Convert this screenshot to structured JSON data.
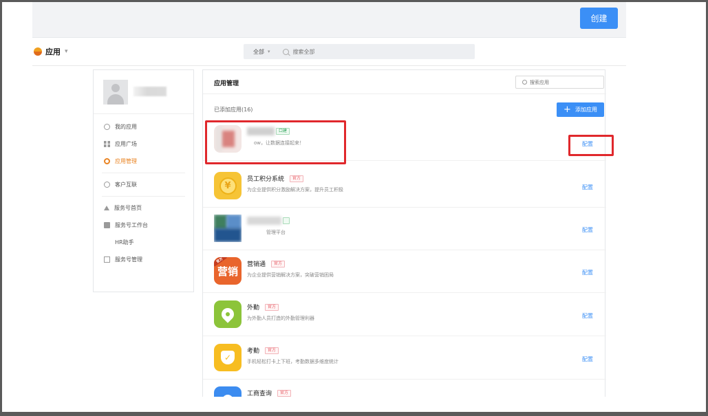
{
  "topbar": {
    "create_label": "创建"
  },
  "nav": {
    "app_menu_label": "应用",
    "search_scope": "全部",
    "search_placeholder": "搜索全部"
  },
  "sidebar": {
    "items": [
      {
        "label": "我的应用",
        "icon": "gear-icon"
      },
      {
        "label": "应用广场",
        "icon": "grid-icon"
      },
      {
        "label": "应用管理",
        "icon": "gear-icon",
        "active": true
      },
      {
        "label": "客户互联",
        "icon": "chat-icon"
      },
      {
        "label": "服务号首页",
        "icon": "home-icon"
      },
      {
        "label": "服务号工作台",
        "icon": "desk-icon"
      },
      {
        "label": "HR助手",
        "icon": ""
      },
      {
        "label": "服务号管理",
        "icon": "manage-icon"
      }
    ]
  },
  "panel": {
    "title": "应用管理",
    "search_placeholder": "搜索应用",
    "added_count": "已添加应用(16)",
    "add_button": "添加应用",
    "config_label": "配置",
    "official_tag": "官方",
    "apps": [
      {
        "name": "",
        "tag": "口建",
        "desc": "ow，让数据连接起来！",
        "icon": "blurred"
      },
      {
        "name": "员工积分系统",
        "tag": "官方",
        "desc": "为企业提供积分激励解决方案，提升员工积极",
        "icon": "coin-icon"
      },
      {
        "name": "",
        "tag": "",
        "desc": "管理平台",
        "icon": "blurred"
      },
      {
        "name": "营销通",
        "tag": "官方",
        "desc": "为企业提供营销解决方案，突破营销困局",
        "icon": "market-icon",
        "icon_text": "营销",
        "badge": "官方"
      },
      {
        "name": "外勤",
        "tag": "官方",
        "desc": "为外勤人员打造的外勤管理利器",
        "icon": "location-pin-icon"
      },
      {
        "name": "考勤",
        "tag": "官方",
        "desc": "手机轻松打卡上下班，考勤数据多维度统计",
        "icon": "shield-check-icon"
      },
      {
        "name": "工商查询",
        "tag": "官方",
        "desc": "",
        "icon": "search-ring-icon"
      }
    ]
  },
  "colors": {
    "accent": "#3b8ff6",
    "active_menu": "#e98322",
    "highlight": "#e0282c"
  }
}
